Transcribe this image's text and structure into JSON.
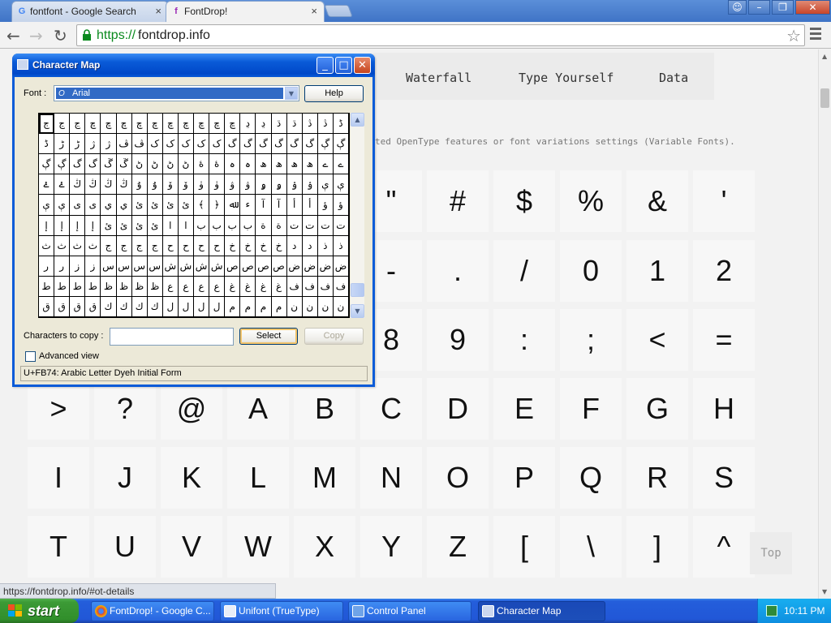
{
  "browser": {
    "tabs": [
      {
        "title": "fontfont - Google Search",
        "favicon": "G"
      },
      {
        "title": "FontDrop!",
        "favicon": "f"
      }
    ],
    "url_scheme": "https://",
    "url_host": "fontdrop.info",
    "window_controls": [
      "user-icon",
      "minimize-icon",
      "restore-icon",
      "close-icon"
    ]
  },
  "site": {
    "nav": [
      "Waterfall",
      "Type Yourself",
      "Data"
    ],
    "description": "ted OpenType features or font variations settings (Variable Fonts).",
    "glyph_rows": [
      [
        "\"",
        "#",
        "$",
        "%",
        "&",
        "'"
      ],
      [
        "-",
        ".",
        "/",
        "0",
        "1",
        "2"
      ],
      [
        "8",
        "9",
        ":",
        ";",
        "<",
        "="
      ],
      [
        ">",
        "?",
        "@",
        "A",
        "B",
        "C",
        "D",
        "E",
        "F",
        "G",
        "H"
      ],
      [
        "I",
        "J",
        "K",
        "L",
        "M",
        "N",
        "O",
        "P",
        "Q",
        "R",
        "S"
      ],
      [
        "T",
        "U",
        "V",
        "W",
        "X",
        "Y",
        "Z",
        "[",
        "\\",
        "]",
        "^"
      ]
    ],
    "top_button": "Top",
    "status_url": "https://fontdrop.info/#ot-details"
  },
  "charmap": {
    "title": "Character Map",
    "font_label": "Font :",
    "font_value": "Arial",
    "help_label": "Help",
    "grid": [
      "ڄ ڃ ڃ ڇ ڇ ڇ ڇ ڇ ڇ ڇ ڇ ڇ ڇ ڍ ڍ ڌ ڌ ڎ ڎ ڈ",
      "ڈ ڑ ڑ ژ ژ ڤ ڤ ک ک ک ک ک گ گ گ گ گ گ ڳ ڳ",
      "ڳ ڳ گ گ ڱ ڱ ڻ ڻ ڻ ڻ ۀ ۀ ہ ہ ھ ھ ھ ھ ے ے",
      "ۓ ۓ ڭ ڭ ڭ ڭ ۇ ۇ ۆ ۆ ۈ ۈ ۋ ۋ ۅ ۅ ۉ ۉ ې ې",
      "ې ې ى ى ي ي ئ ئ ئ ئ ﴾ ﴿ ﷲ ء آ آ أ أ ؤ ؤ",
      "إ إ إ إ ئ ئ ئ ئ ا ا ب ب ب ب ة ة ت ت ت ت",
      "ث ث ث ث ج ج ج ج ح ح ح ح خ خ خ خ د د ذ ذ",
      "ر ر ز ز س س س س ش ش ش ش ص ص ص ص ض ض ض ض",
      "ط ط ط ط ظ ظ ظ ظ ع ع ع ع غ غ غ غ ف ف ف ف",
      "ق ق ق ق ك ك ك ك ل ل ل ل م م م م ن ن ن ن"
    ],
    "copy_label": "Characters to copy :",
    "copy_value": "",
    "select_label": "Select",
    "copy_button": "Copy",
    "advanced_label": "Advanced view",
    "status": "U+FB74: Arabic Letter Dyeh Initial Form"
  },
  "taskbar": {
    "start": "start",
    "tasks": [
      {
        "label": "FontDrop! - Google C...",
        "icon": "chrome-icon"
      },
      {
        "label": "Unifont (TrueType)",
        "icon": "font-file-icon"
      },
      {
        "label": "Control Panel",
        "icon": "control-panel-icon"
      },
      {
        "label": "Character Map",
        "icon": "charmap-icon"
      }
    ],
    "clock": "10:11 PM"
  }
}
